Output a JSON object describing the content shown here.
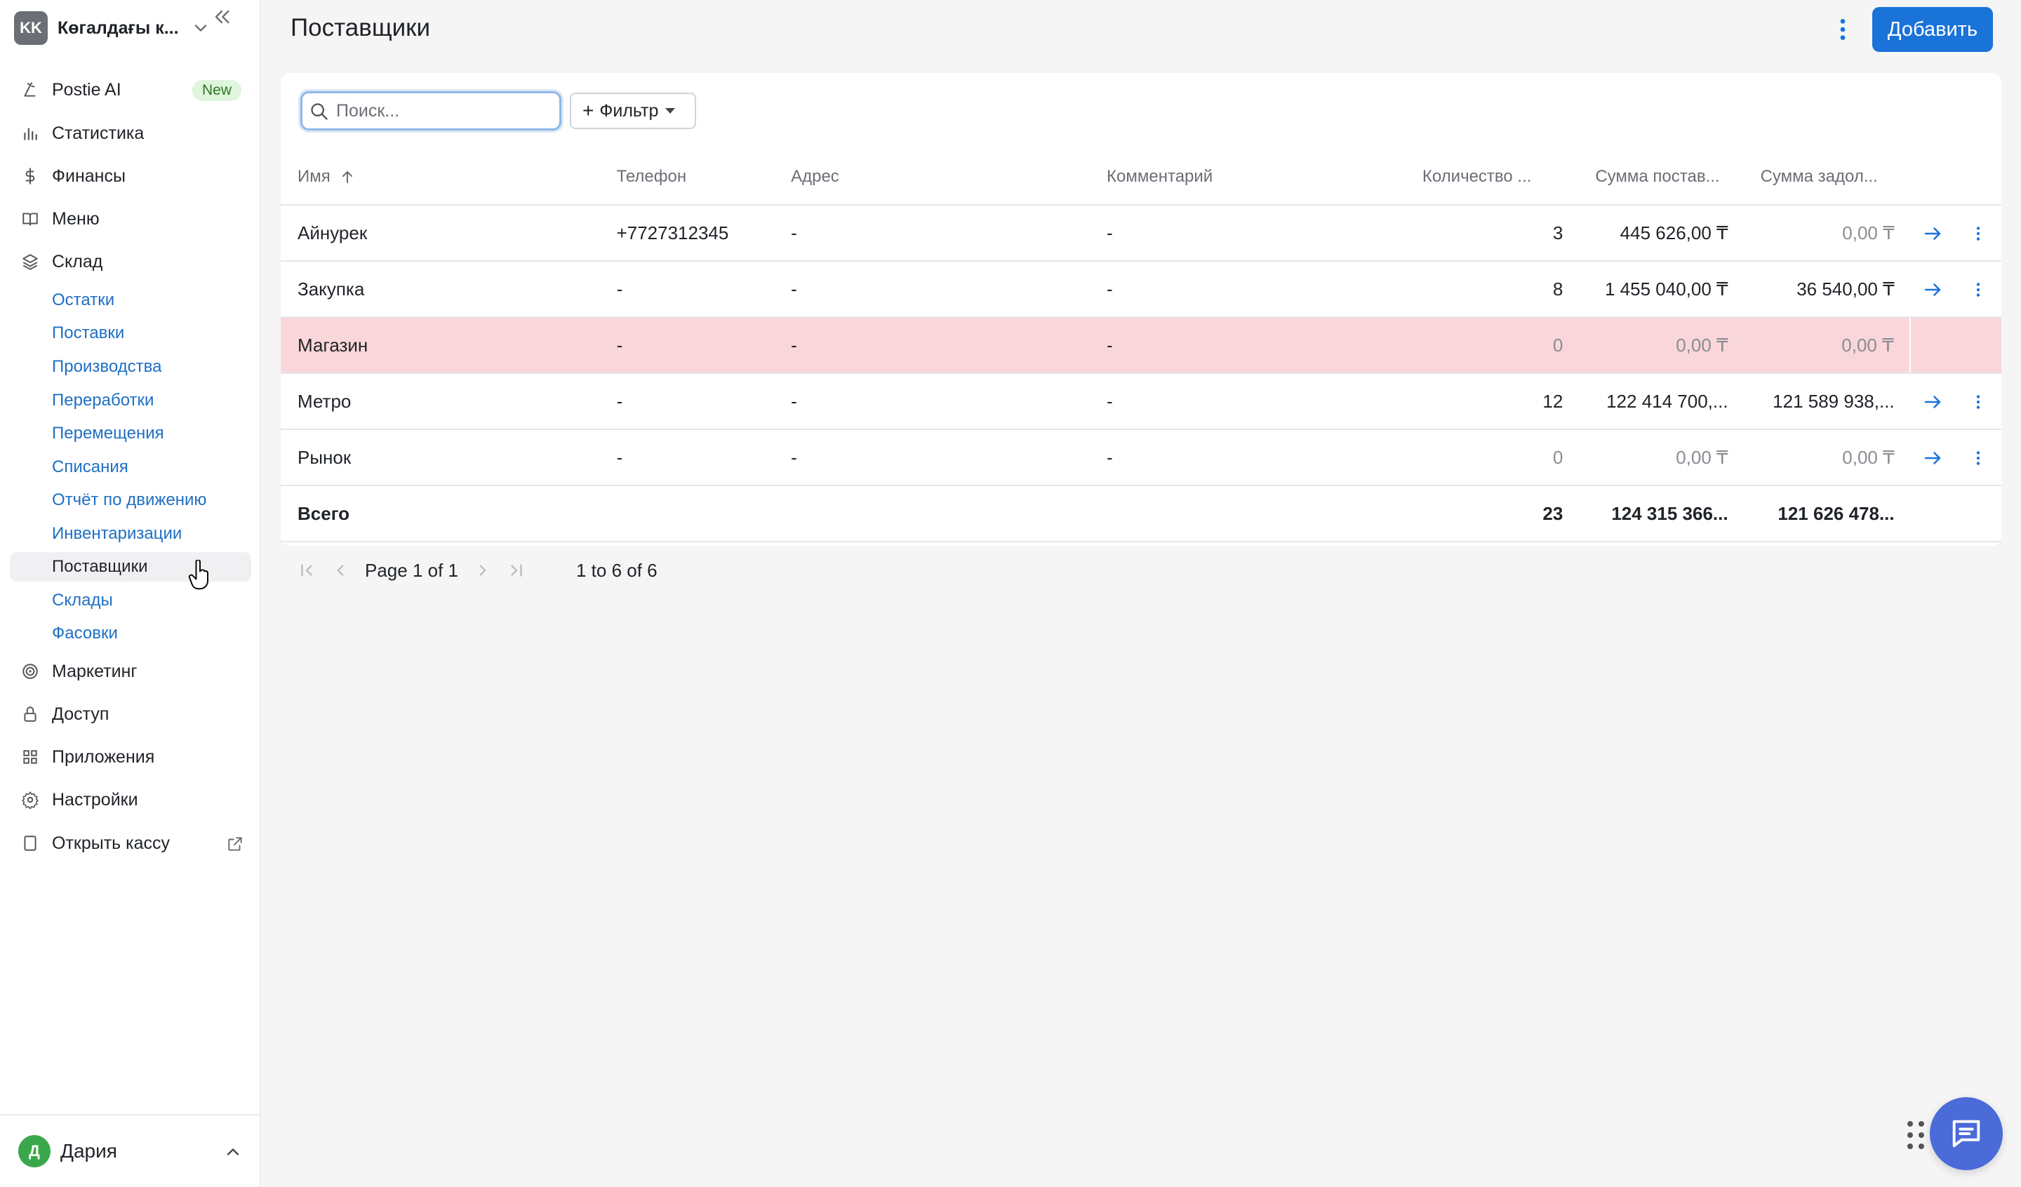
{
  "org": {
    "initials": "KK",
    "name": "Көгалдағы к..."
  },
  "nav": {
    "postie_ai": "Postie AI",
    "new_badge": "New",
    "statistics": "Статистика",
    "finance": "Финансы",
    "menu": "Меню",
    "warehouse": "Склад",
    "sub": [
      "Остатки",
      "Поставки",
      "Производства",
      "Переработки",
      "Перемещения",
      "Списания",
      "Отчёт по движению",
      "Инвентаризации",
      "Поставщики",
      "Склады",
      "Фасовки"
    ],
    "marketing": "Маркетинг",
    "access": "Доступ",
    "apps": "Приложения",
    "settings": "Настройки",
    "open_cash": "Открыть кассу"
  },
  "user": {
    "initial": "Д",
    "name": "Дария"
  },
  "header": {
    "title": "Поставщики",
    "add_label": "Добавить"
  },
  "search": {
    "placeholder": "Поиск..."
  },
  "filter": {
    "label": "Фильтр"
  },
  "table": {
    "columns": [
      "Имя",
      "Телефон",
      "Адрес",
      "Комментарий",
      "Количество ...",
      "Сумма постав...",
      "Сумма задол..."
    ],
    "rows": [
      {
        "name": "Айнурек",
        "phone": "+7727312345",
        "address": "-",
        "comment": "-",
        "count": "3",
        "supply_sum": "445 626,00 ₸",
        "debt_sum": "0,00 ₸"
      },
      {
        "name": "Закупка",
        "phone": "-",
        "address": "-",
        "comment": "-",
        "count": "8",
        "supply_sum": "1 455 040,00 ₸",
        "debt_sum": "36 540,00 ₸"
      },
      {
        "name": "Магазин",
        "phone": "-",
        "address": "-",
        "comment": "-",
        "count": "0",
        "supply_sum": "0,00 ₸",
        "debt_sum": "0,00 ₸"
      },
      {
        "name": "Метро",
        "phone": "-",
        "address": "-",
        "comment": "-",
        "count": "12",
        "supply_sum": "122 414 700,...",
        "debt_sum": "121 589 938,..."
      },
      {
        "name": "Рынок",
        "phone": "-",
        "address": "-",
        "comment": "-",
        "count": "0",
        "supply_sum": "0,00 ₸",
        "debt_sum": "0,00 ₸"
      }
    ],
    "total": {
      "label": "Всего",
      "count": "23",
      "supply_sum": "124 315 366...",
      "debt_sum": "121 626 478..."
    }
  },
  "pager": {
    "page_text": "Page 1 of 1",
    "range_text": "1 to 6 of 6"
  },
  "colors": {
    "accent": "#1a73d9",
    "link": "#1f6fc4",
    "highlight_row": "#f9d6da",
    "chat": "#4a6bd8"
  }
}
